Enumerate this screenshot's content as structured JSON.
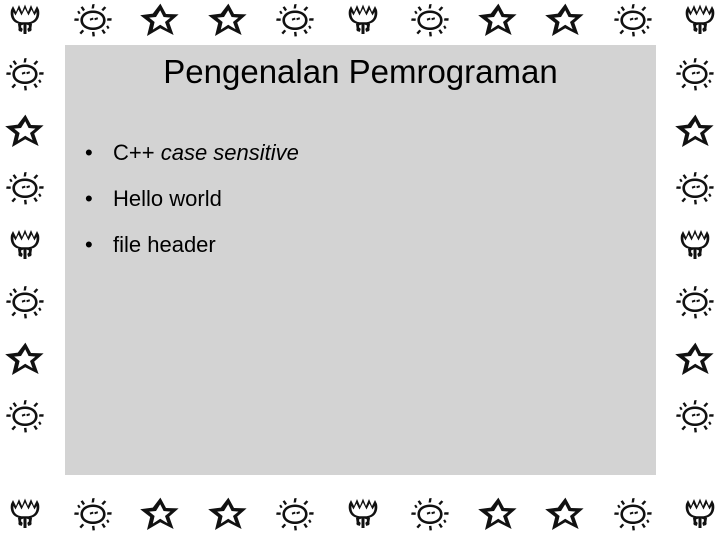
{
  "slide": {
    "title": "Pengenalan Pemrograman",
    "background_color": "#ffffff",
    "panel_color": "#d3d3d3",
    "ink_color": "#000000",
    "bullet_marker": "•",
    "bullets": [
      {
        "text_plain": "C++ ",
        "text_italic": "case sensitive"
      },
      {
        "text_plain": "Hello world",
        "text_italic": ""
      },
      {
        "text_plain": "file header",
        "text_italic": ""
      }
    ]
  },
  "border": {
    "icon_names": [
      "tulip-icon",
      "sun-icon",
      "star-icon"
    ],
    "top_sequence": [
      "tulip",
      "sun",
      "star",
      "star",
      "sun",
      "tulip",
      "sun",
      "star",
      "star",
      "sun",
      "tulip"
    ],
    "bottom_sequence": [
      "tulip",
      "sun",
      "star",
      "star",
      "sun",
      "tulip",
      "sun",
      "star",
      "star",
      "sun",
      "tulip"
    ],
    "left_sequence": [
      "sun",
      "star",
      "sun",
      "tulip",
      "sun",
      "star",
      "sun"
    ],
    "right_sequence": [
      "sun",
      "star",
      "sun",
      "tulip",
      "sun",
      "star",
      "sun"
    ]
  }
}
